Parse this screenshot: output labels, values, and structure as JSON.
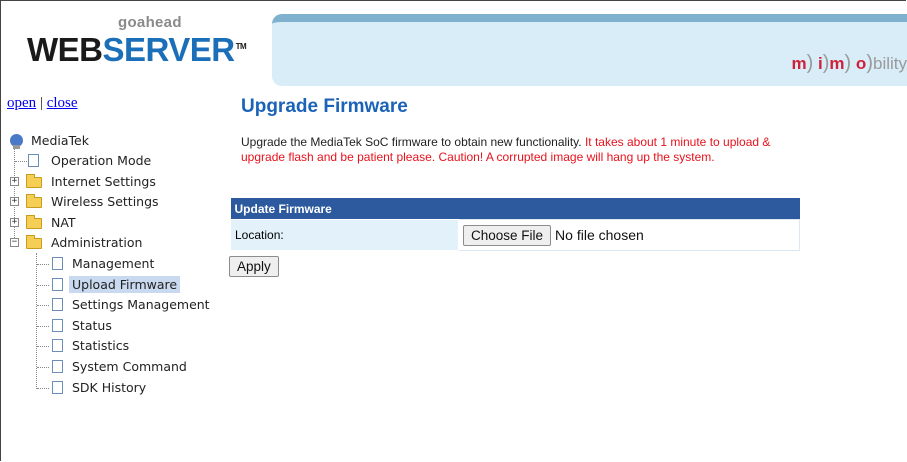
{
  "header": {
    "logo_top": "goahead",
    "logo_web": "WEB",
    "logo_server": "SERVER",
    "logo_tm": "TM",
    "brand": {
      "m1": "m",
      "i": "i",
      "m2": "m",
      "o": "o",
      "rest": "bility"
    }
  },
  "nav": {
    "open_label": "open",
    "separator": "|",
    "close_label": "close",
    "tree": {
      "root": "MediaTek",
      "operation_mode": "Operation Mode",
      "internet_settings": "Internet Settings",
      "wireless_settings": "Wireless Settings",
      "nat": "NAT",
      "administration": "Administration",
      "admin_items": [
        "Management",
        "Upload Firmware",
        "Settings Management",
        "Status",
        "Statistics",
        "System Command",
        "SDK History"
      ],
      "selected": "Upload Firmware"
    }
  },
  "main": {
    "title": "Upgrade Firmware",
    "description": "Upgrade the MediaTek SoC firmware to obtain new functionality. ",
    "warning": "It takes about 1 minute to upload & upgrade flash and be patient please. Caution! A corrupted image will hang up the system.",
    "table_header": "Update Firmware",
    "location_label": "Location:",
    "choose_file_label": "Choose File",
    "no_file_text": "No file chosen",
    "apply_label": "Apply"
  },
  "colors": {
    "accent_blue": "#1b63b8",
    "table_header": "#2d5a9e",
    "warning_red": "#e8121c"
  }
}
